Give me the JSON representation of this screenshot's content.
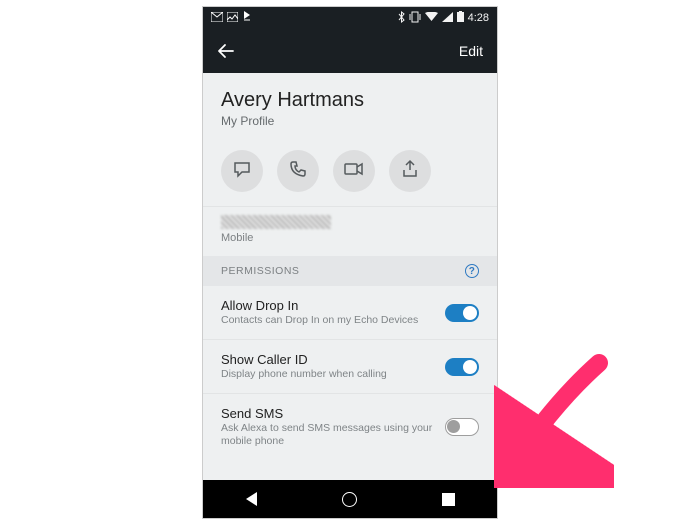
{
  "status": {
    "time": "4:28"
  },
  "appbar": {
    "edit": "Edit"
  },
  "profile": {
    "name": "Avery Hartmans",
    "subtitle": "My Profile"
  },
  "phone": {
    "label": "Mobile"
  },
  "permissions": {
    "header": "PERMISSIONS",
    "items": [
      {
        "title": "Allow Drop In",
        "subtitle": "Contacts can Drop In on my Echo Devices",
        "on": true
      },
      {
        "title": "Show Caller ID",
        "subtitle": "Display phone number when calling",
        "on": true
      },
      {
        "title": "Send SMS",
        "subtitle": "Ask Alexa to send SMS messages using your mobile phone",
        "on": false
      }
    ]
  }
}
